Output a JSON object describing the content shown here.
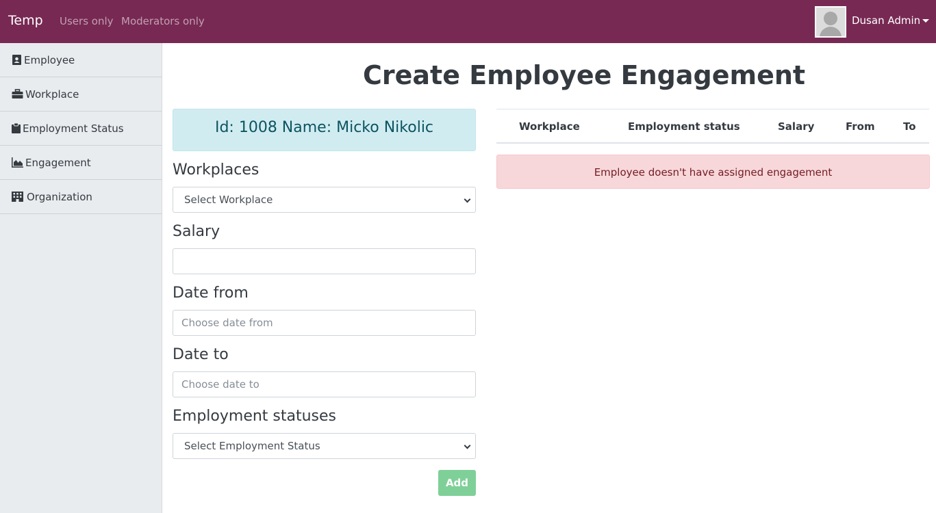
{
  "navbar": {
    "brand": "Temp",
    "links": [
      "Users only",
      "Moderators only"
    ],
    "user_name": "Dusan Admin",
    "bg_color": "#772953"
  },
  "sidebar": {
    "items": [
      {
        "label": "Employee",
        "icon": "id-card-icon"
      },
      {
        "label": "Workplace",
        "icon": "briefcase-icon"
      },
      {
        "label": "Employment Status",
        "icon": "clipboard-icon"
      },
      {
        "label": "Engagement",
        "icon": "area-chart-icon"
      },
      {
        "label": "Organization",
        "icon": "building-icon"
      }
    ]
  },
  "main": {
    "title": "Create Employee Engagement",
    "employee_info": "Id: 1008 Name: Micko Nikolic",
    "form": {
      "workplaces_label": "Workplaces",
      "workplace_select": "Select Workplace",
      "salary_label": "Salary",
      "salary_value": "",
      "date_from_label": "Date from",
      "date_from_placeholder": "Choose date from",
      "date_to_label": "Date to",
      "date_to_placeholder": "Choose date to",
      "statuses_label": "Employment statuses",
      "status_select": "Select Employment Status",
      "add_button": "Add"
    },
    "table": {
      "headers": [
        "Workplace",
        "Employment status",
        "Salary",
        "From",
        "To"
      ]
    },
    "alert": "Employee doesn't have assigned engagement"
  }
}
